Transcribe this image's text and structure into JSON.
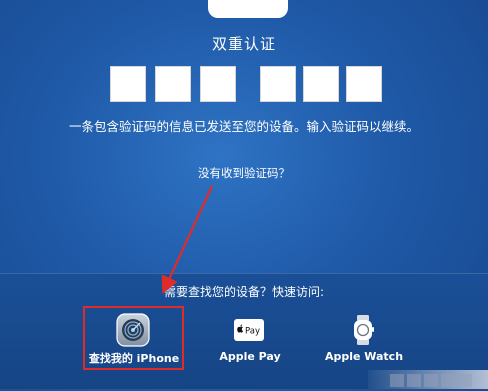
{
  "header": {
    "title": "双重认证"
  },
  "verification": {
    "message": "一条包含验证码的信息已发送至您的设备。输入验证码以继续。",
    "no_code_link": "没有收到验证码？"
  },
  "quick_access": {
    "prompt": "需要查找您的设备？快速访问:",
    "apps": [
      {
        "label": "查找我的 iPhone",
        "icon": "find-my-iphone-icon"
      },
      {
        "label": "Apple Pay",
        "icon": "apple-pay-icon"
      },
      {
        "label": "Apple Watch",
        "icon": "apple-watch-icon"
      }
    ]
  },
  "colors": {
    "background": "#1f5aa8",
    "highlight": "#e02b2b",
    "arrow": "#e02b2b"
  }
}
